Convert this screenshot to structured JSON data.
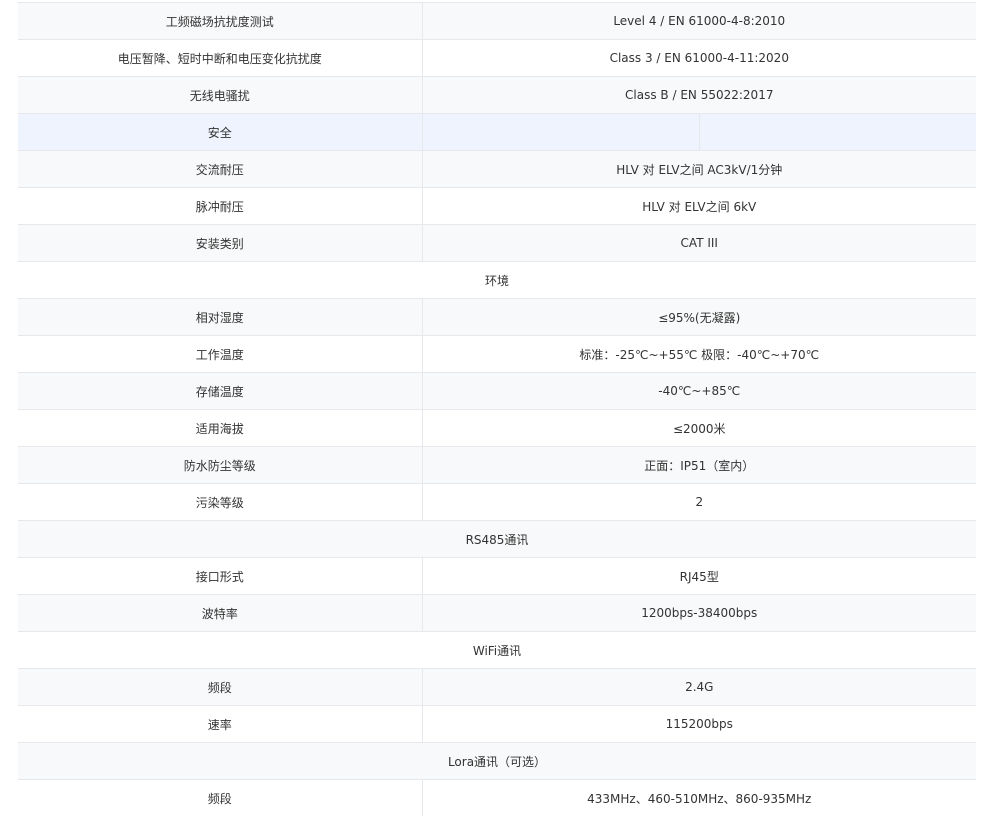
{
  "rows": [
    {
      "type": "kv",
      "label": "工频磁场抗扰度测试",
      "value": "Level 4 / EN 61000-4-8:2010"
    },
    {
      "type": "kv",
      "label": "电压暂降、短时中断和电压变化抗扰度",
      "value": "Class 3 / EN 61000-4-11:2020"
    },
    {
      "type": "kv",
      "label": "无线电骚扰",
      "value": "Class B  / EN 55022:2017"
    },
    {
      "type": "group",
      "label": "安全"
    },
    {
      "type": "kv",
      "label": "交流耐压",
      "value": "HLV 对 ELV之间 AC3kV/1分钟"
    },
    {
      "type": "kv",
      "label": "脉冲耐压",
      "value": "HLV 对 ELV之间 6kV"
    },
    {
      "type": "kv",
      "label": "安装类别",
      "value": "CAT III"
    },
    {
      "type": "section",
      "label": "环境"
    },
    {
      "type": "kv",
      "label": "相对湿度",
      "value": "≤95%(无凝露)"
    },
    {
      "type": "kv",
      "label": "工作温度",
      "value": "标准：-25℃~+55℃ 极限：-40℃~+70℃"
    },
    {
      "type": "kv",
      "label": "存储温度",
      "value": "-40℃~+85℃"
    },
    {
      "type": "kv",
      "label": "适用海拔",
      "value": "≤2000米"
    },
    {
      "type": "kv",
      "label": "防水防尘等级",
      "value": "正面：IP51（室内）"
    },
    {
      "type": "kv",
      "label": "污染等级",
      "value": "2"
    },
    {
      "type": "section",
      "label": "RS485通讯"
    },
    {
      "type": "kv",
      "label": "接口形式",
      "value": "RJ45型"
    },
    {
      "type": "kv",
      "label": "波特率",
      "value": "1200bps-38400bps"
    },
    {
      "type": "section",
      "label": "WiFi通讯"
    },
    {
      "type": "kv",
      "label": "频段",
      "value": "2.4G"
    },
    {
      "type": "kv",
      "label": "速率",
      "value": "115200bps"
    },
    {
      "type": "section",
      "label": "Lora通讯（可选）"
    },
    {
      "type": "kv",
      "label": "频段",
      "value": "433MHz、460-510MHz、860-935MHz"
    }
  ],
  "colors": {
    "border": "#e6e8ec",
    "row_alt_bg": "#f8f9fa",
    "row_highlight_bg": "#eef3fd",
    "text": "#333333"
  }
}
